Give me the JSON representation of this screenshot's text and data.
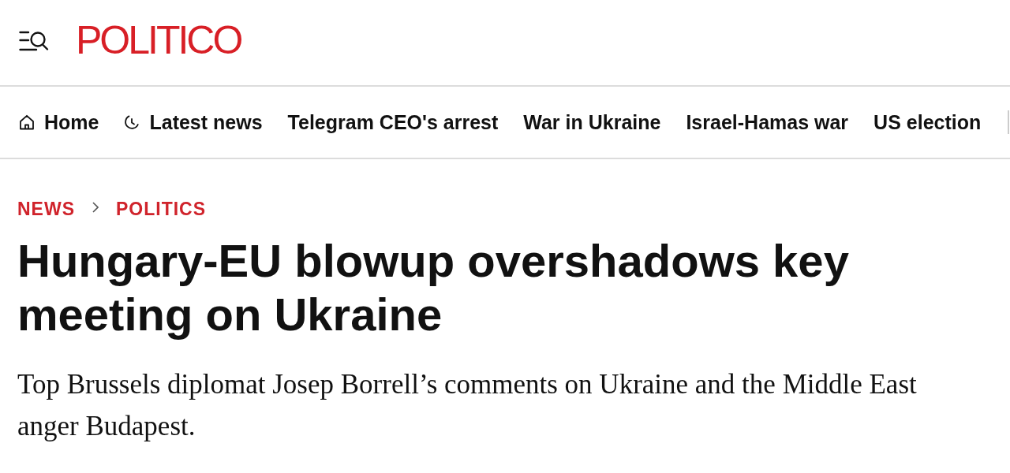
{
  "header": {
    "logo": "POLITICO"
  },
  "nav": {
    "items": [
      {
        "label": "Home",
        "kind": "home"
      },
      {
        "label": "Latest news",
        "kind": "latest"
      },
      {
        "label": "Telegram CEO's arrest",
        "kind": "plain"
      },
      {
        "label": "War in Ukraine",
        "kind": "plain"
      },
      {
        "label": "Israel-Hamas war",
        "kind": "plain"
      },
      {
        "label": "US election",
        "kind": "plain"
      }
    ]
  },
  "breadcrumb": [
    "NEWS",
    "POLITICS"
  ],
  "article": {
    "headline": "Hungary-EU blowup overshadows key meeting on Ukraine",
    "dek": "Top Brussels diplomat Josep Borrell’s comments on Ukraine and the Middle East anger Budapest."
  }
}
